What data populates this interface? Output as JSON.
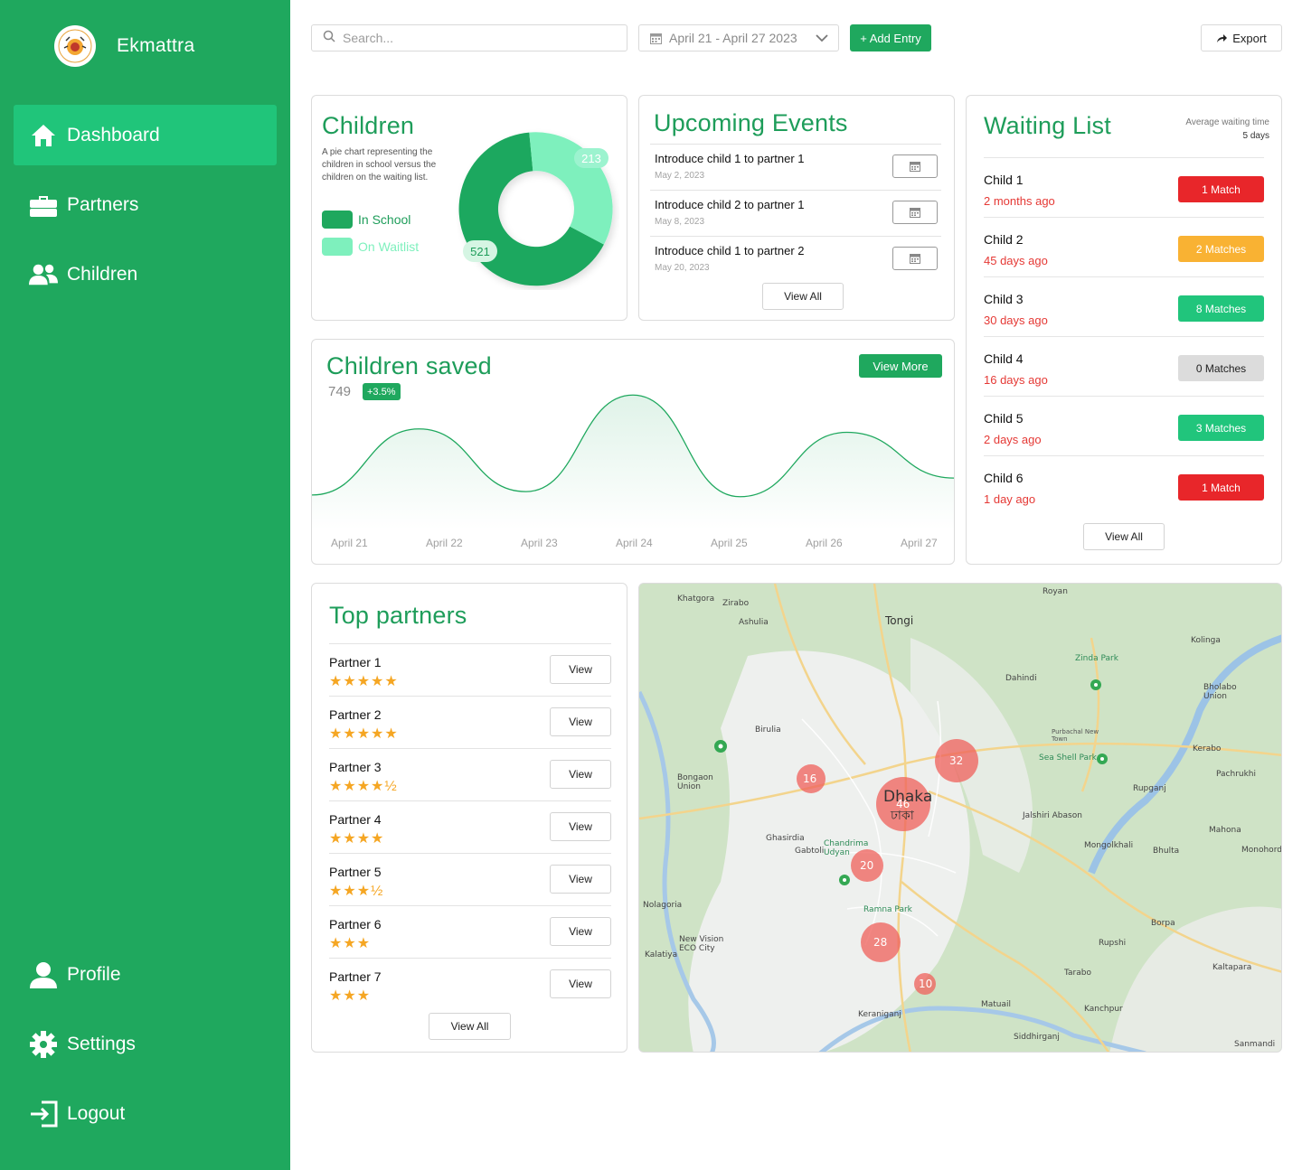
{
  "app": {
    "name": "Ekmattra"
  },
  "sidebar": {
    "items": [
      {
        "label": "Dashboard",
        "icon": "home-icon",
        "active": true
      },
      {
        "label": "Partners",
        "icon": "briefcase-icon"
      },
      {
        "label": "Children",
        "icon": "users-icon"
      }
    ],
    "bottom_items": [
      {
        "label": "Profile",
        "icon": "user-icon"
      },
      {
        "label": "Settings",
        "icon": "gear-icon"
      },
      {
        "label": "Logout",
        "icon": "logout-icon"
      }
    ]
  },
  "topbar": {
    "search_placeholder": "Search...",
    "date_range": "April 21 - April 27 2023",
    "add_label": "+ Add Entry",
    "export_label": "Export"
  },
  "children_card": {
    "title": "Children",
    "description": "A pie chart representing the children in school versus the children on the waiting list.",
    "legend": [
      {
        "label": "In School",
        "color": "#1fa85e"
      },
      {
        "label": "On Waitlist",
        "color": "#7ef0bd"
      }
    ],
    "in_school_value": "521",
    "waitlist_value": "213"
  },
  "events": {
    "title": "Upcoming Events",
    "items": [
      {
        "title": "Introduce child 1 to partner 1",
        "date": "May 2, 2023"
      },
      {
        "title": "Introduce child 2 to partner 1",
        "date": "May 8, 2023"
      },
      {
        "title": "Introduce child 1 to partner 2",
        "date": "May 20, 2023"
      }
    ],
    "view_all": "View All"
  },
  "waiting": {
    "title": "Waiting List",
    "avg_label": "Average waiting time",
    "avg_value": "5 days",
    "items": [
      {
        "name": "Child 1",
        "time": "2 months ago",
        "badge": "1 Match",
        "color": "#e8262a"
      },
      {
        "name": "Child 2",
        "time": "45 days ago",
        "badge": "2 Matches",
        "color": "#f9b233"
      },
      {
        "name": "Child 3",
        "time": "30 days ago",
        "badge": "8 Matches",
        "color": "#21c57c"
      },
      {
        "name": "Child 4",
        "time": "16 days ago",
        "badge": "0 Matches",
        "color": "#dcdcdc"
      },
      {
        "name": "Child 5",
        "time": "2 days ago",
        "badge": "3 Matches",
        "color": "#21c57c"
      },
      {
        "name": "Child 6",
        "time": "1 day ago",
        "badge": "1 Match",
        "color": "#e8262a"
      }
    ],
    "view_all": "View All"
  },
  "saved": {
    "title": "Children saved",
    "value": "749",
    "change": "+3.5%",
    "view_more": "View More"
  },
  "chart_data": {
    "type": "area",
    "categories": [
      "April 21",
      "April 22",
      "April 23",
      "April 24",
      "April 25",
      "April 26",
      "April 27"
    ],
    "values": [
      0.5,
      4.4,
      0.7,
      6.4,
      0.4,
      4.2,
      1.5
    ],
    "title": "Children saved",
    "ylim": [
      -1,
      7
    ],
    "grid": false
  },
  "partners": {
    "title": "Top partners",
    "view_label": "View",
    "items": [
      {
        "name": "Partner 1",
        "stars": "★★★★★",
        "rating": 5
      },
      {
        "name": "Partner 2",
        "stars": "★★★★★",
        "rating": 5
      },
      {
        "name": "Partner 3",
        "stars": "★★★★½",
        "rating": 4.5
      },
      {
        "name": "Partner 4",
        "stars": "★★★★",
        "rating": 4
      },
      {
        "name": "Partner 5",
        "stars": "★★★½",
        "rating": 3.5
      },
      {
        "name": "Partner 6",
        "stars": "★★★",
        "rating": 3
      },
      {
        "name": "Partner 7",
        "stars": "★★★",
        "rating": 3
      }
    ],
    "view_all": "View All"
  },
  "map": {
    "city": "Dhaka",
    "city_bn": "ঢাকা",
    "clusters": [
      "16",
      "32",
      "46",
      "20",
      "28",
      "10"
    ],
    "places": [
      "Khatgora",
      "Zirabo",
      "Ashulia",
      "Tongi",
      "Royan",
      "Kolinga",
      "Zinda Park",
      "Dahindi",
      "Bholabo Union",
      "Birulia",
      "Purbachal New Town",
      "Kerabo",
      "Sea Shell Park",
      "Bongaon Union",
      "Rupganj",
      "Pachrukhi",
      "Jalshiri Abason",
      "Mahona",
      "Ghasirdia",
      "Gabtoli",
      "Chandrima Udyan",
      "Mongolkhali",
      "Bhulta",
      "Monohordi",
      "Nolagoria",
      "Ramna Park",
      "Borpa",
      "New Vision ECO City",
      "Kalatiya",
      "Rupshi",
      "Kaltapara",
      "Tarabo",
      "Matuail",
      "Kanchpur",
      "Keraniganj",
      "Siddhirganj",
      "Sanmandi"
    ]
  }
}
